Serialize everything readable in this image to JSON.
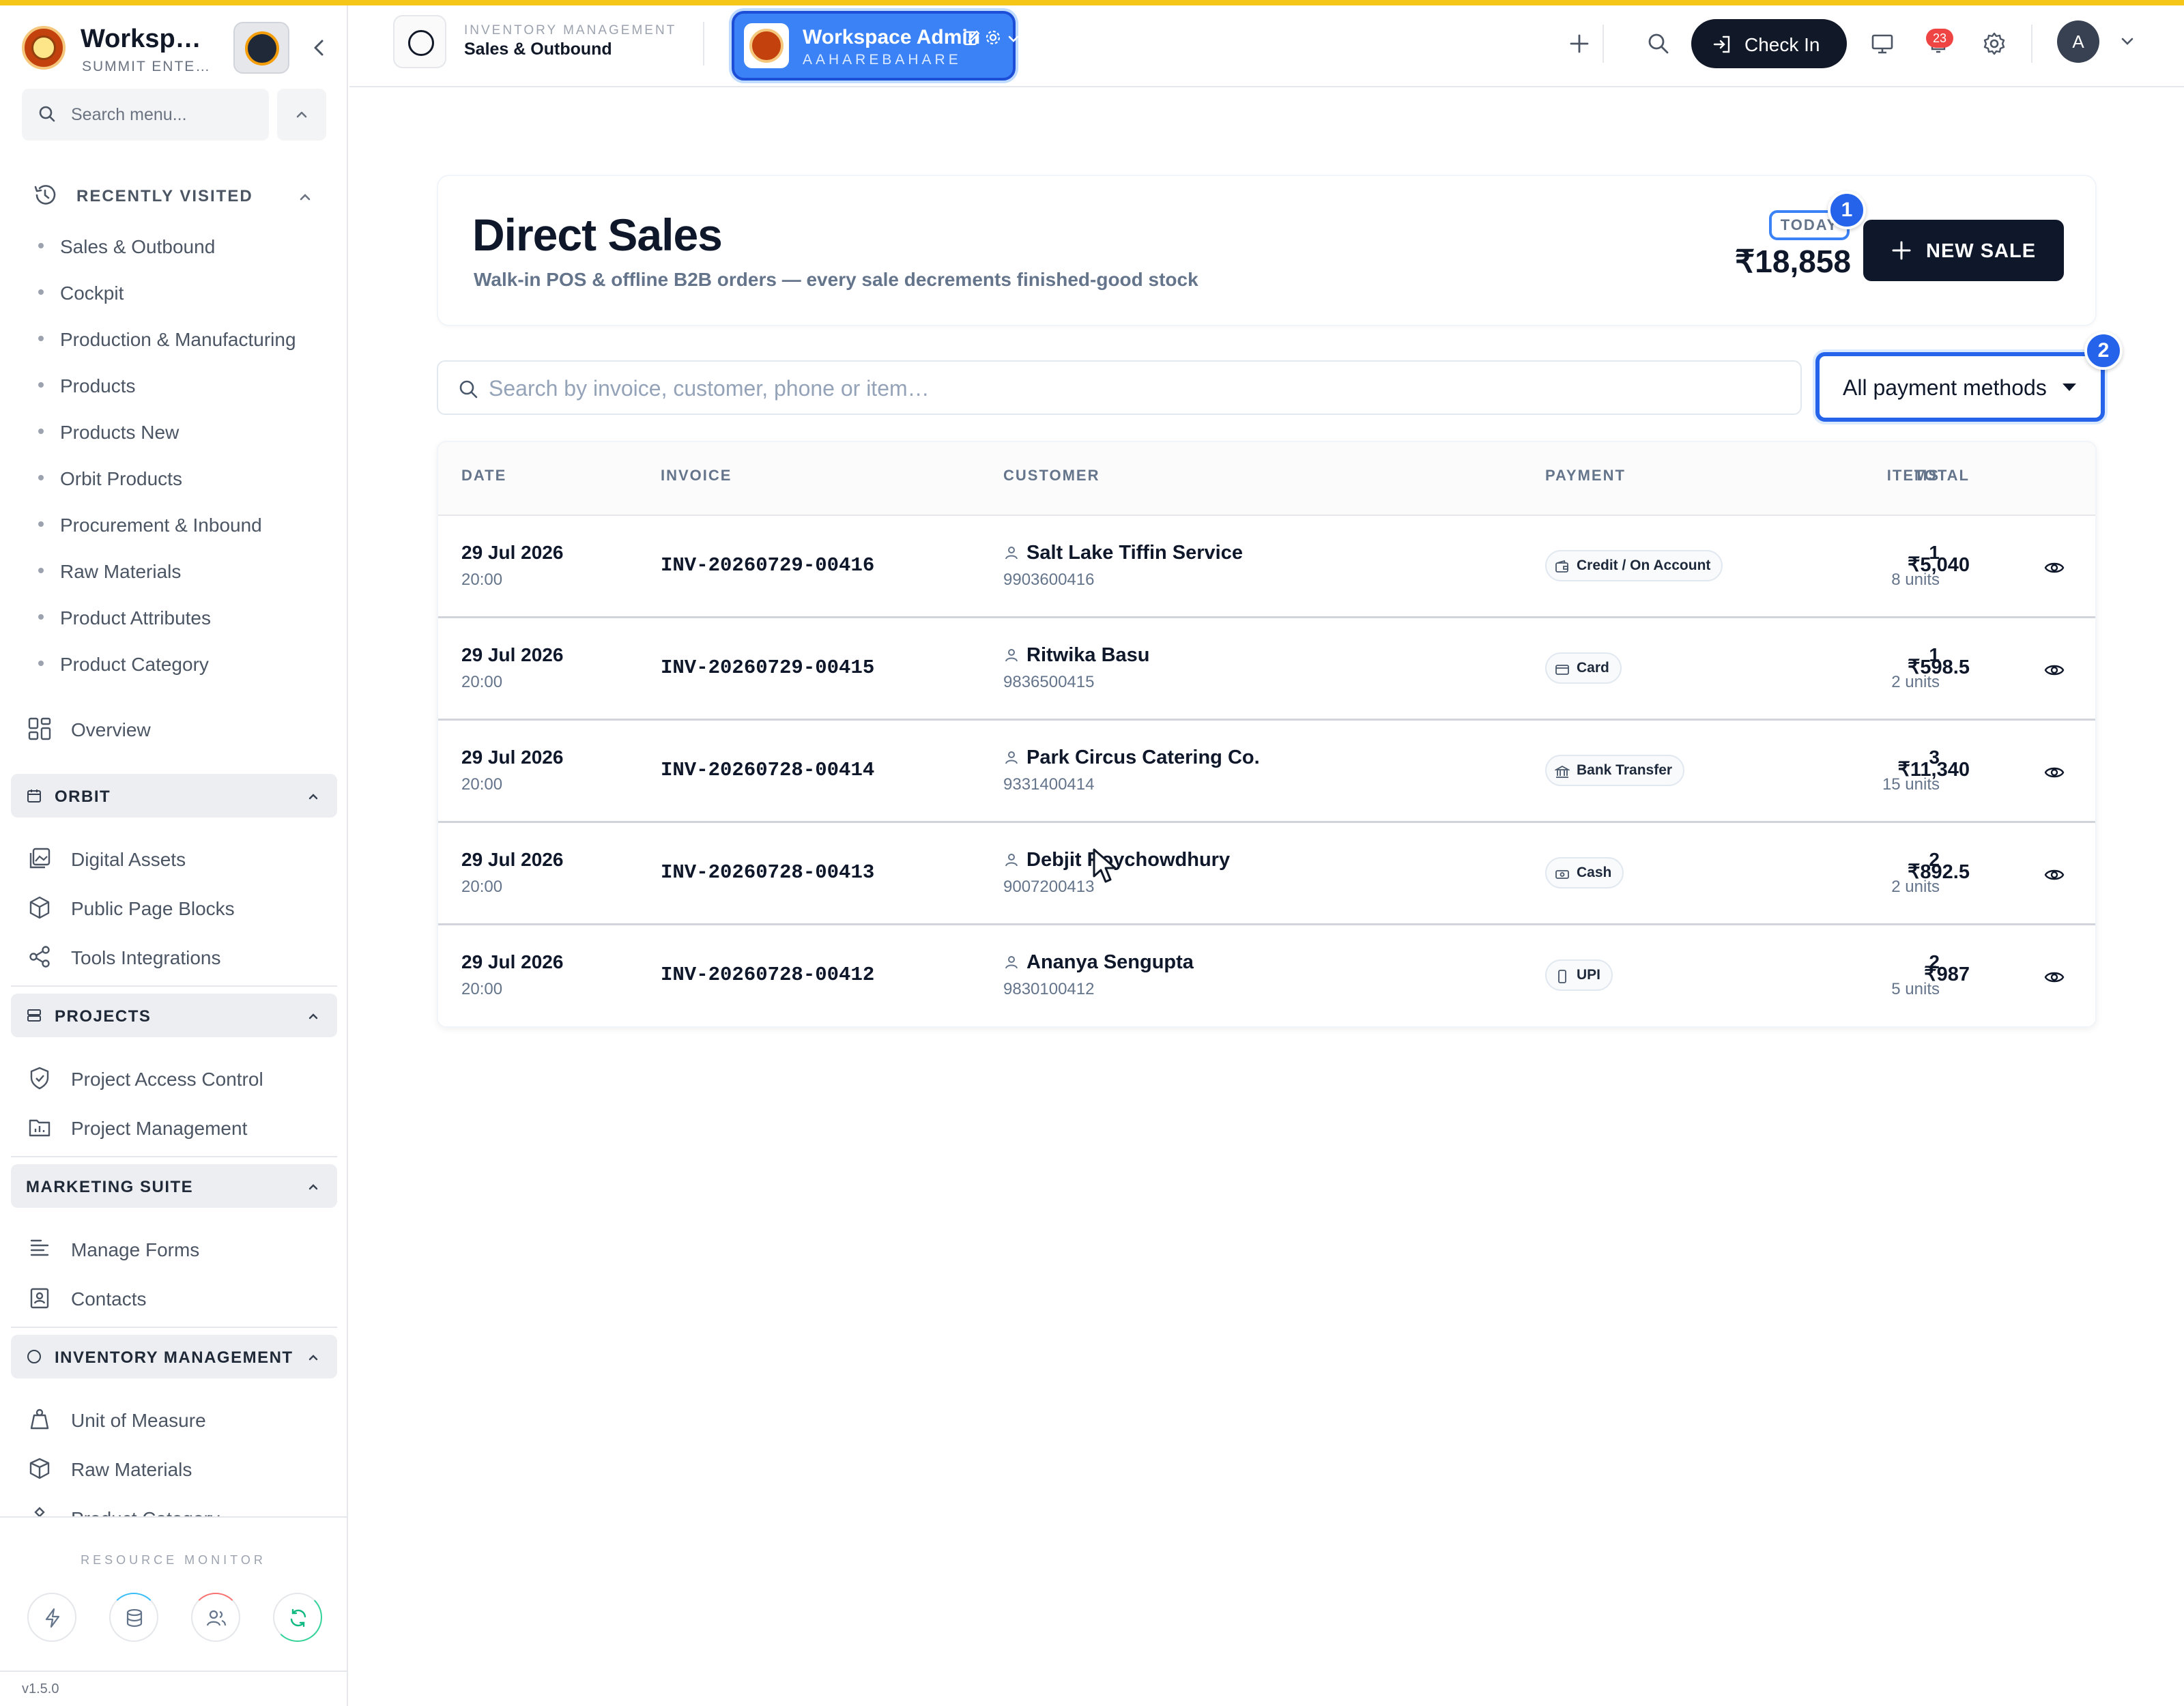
{
  "brand": {
    "name": "Worksp…",
    "subtitle": "SUMMIT ENTE…"
  },
  "sidebar": {
    "search_placeholder": "Search menu...",
    "recently_visited": {
      "label": "RECENTLY VISITED",
      "items": [
        "Sales & Outbound",
        "Cockpit",
        "Production & Manufacturing",
        "Products",
        "Products New",
        "Orbit Products",
        "Procurement & Inbound",
        "Raw Materials",
        "Product Attributes",
        "Product Category"
      ]
    },
    "overview": "Overview",
    "orbit": {
      "label": "ORBIT",
      "items": [
        "Digital Assets",
        "Public Page Blocks",
        "Tools Integrations"
      ]
    },
    "projects": {
      "label": "PROJECTS",
      "items": [
        "Project Access Control",
        "Project Management"
      ]
    },
    "marketing": {
      "label": "MARKETING SUITE",
      "items": [
        "Manage Forms",
        "Contacts"
      ]
    },
    "inventory": {
      "label": "INVENTORY MANAGEMENT",
      "items": [
        "Unit of Measure",
        "Raw Materials",
        "Product Category"
      ]
    },
    "resource_monitor": "RESOURCE MONITOR",
    "version": "v1.5.0"
  },
  "header": {
    "module": "INVENTORY MANAGEMENT",
    "page": "Sales & Outbound",
    "workspace": {
      "title": "Workspace Admin",
      "subtitle": "AAHAREBAHARE"
    },
    "check_in": "Check In",
    "notifications": "23",
    "avatar": "A"
  },
  "hero": {
    "title": "Direct Sales",
    "subtitle": "Walk-in POS & offline B2B orders — every sale decrements finished-good stock",
    "today_label": "TODAY",
    "today_value": "₹18,858",
    "new_sale": "NEW SALE"
  },
  "markers": {
    "m1": "1",
    "m2": "2"
  },
  "filters": {
    "search_placeholder": "Search by invoice, customer, phone or item…",
    "payment_select": "All payment methods"
  },
  "table": {
    "headers": {
      "date": "DATE",
      "invoice": "INVOICE",
      "customer": "CUSTOMER",
      "items": "ITEMS",
      "payment": "PAYMENT",
      "total": "TOTAL"
    },
    "rows": [
      {
        "date": "29 Jul 2026",
        "time": "20:00",
        "invoice": "INV-20260729-00416",
        "customer": "Salt Lake Tiffin Service",
        "phone": "9903600416",
        "items": "1",
        "units": "8 units",
        "payment": "Credit / On Account",
        "payment_icon": "wallet-icon",
        "total": "₹5,040"
      },
      {
        "date": "29 Jul 2026",
        "time": "20:00",
        "invoice": "INV-20260729-00415",
        "customer": "Ritwika Basu",
        "phone": "9836500415",
        "items": "1",
        "units": "2 units",
        "payment": "Card",
        "payment_icon": "card-icon",
        "total": "₹598.5"
      },
      {
        "date": "29 Jul 2026",
        "time": "20:00",
        "invoice": "INV-20260728-00414",
        "customer": "Park Circus Catering Co.",
        "phone": "9331400414",
        "items": "3",
        "units": "15 units",
        "payment": "Bank Transfer",
        "payment_icon": "bank-icon",
        "total": "₹11,340"
      },
      {
        "date": "29 Jul 2026",
        "time": "20:00",
        "invoice": "INV-20260728-00413",
        "customer": "Debjit Roychowdhury",
        "phone": "9007200413",
        "items": "2",
        "units": "2 units",
        "payment": "Cash",
        "payment_icon": "cash-icon",
        "total": "₹892.5"
      },
      {
        "date": "29 Jul 2026",
        "time": "20:00",
        "invoice": "INV-20260728-00412",
        "customer": "Ananya Sengupta",
        "phone": "9830100412",
        "items": "2",
        "units": "5 units",
        "payment": "UPI",
        "payment_icon": "phone-icon",
        "total": "₹987"
      }
    ]
  },
  "colors": {
    "accent": "#2563eb",
    "topbar": "#f5c518",
    "dark": "#0f172a",
    "badge": "#ef4444"
  }
}
